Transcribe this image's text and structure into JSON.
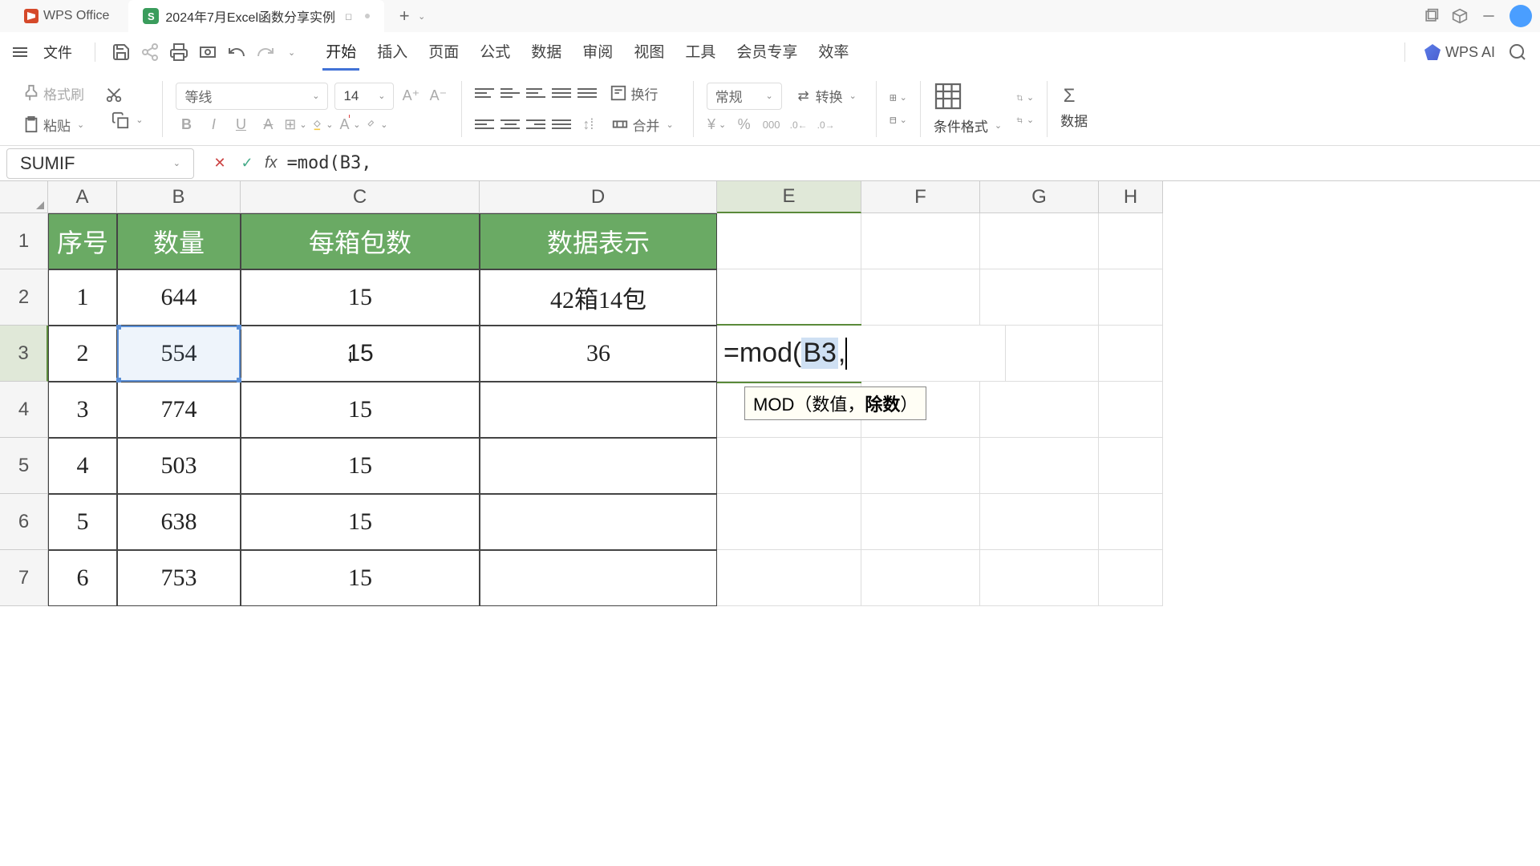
{
  "title_bar": {
    "app_name": "WPS Office",
    "file_tab": "2024年7月Excel函数分享实例"
  },
  "menu": {
    "file": "文件",
    "tabs": [
      "开始",
      "插入",
      "页面",
      "公式",
      "数据",
      "审阅",
      "视图",
      "工具",
      "会员专享",
      "效率"
    ],
    "active_tab": 0,
    "wps_ai": "WPS AI"
  },
  "ribbon": {
    "format_brush": "格式刷",
    "paste": "粘贴",
    "font_name": "等线",
    "font_size": "14",
    "wrap": "换行",
    "merge": "合并",
    "number_format": "常规",
    "convert": "转换",
    "cond_format": "条件格式",
    "data_label": "数据"
  },
  "formula_bar": {
    "name_box": "SUMIF",
    "formula": "=mod(B3,"
  },
  "columns": [
    "A",
    "B",
    "C",
    "D",
    "E",
    "F",
    "G",
    "H"
  ],
  "headers": {
    "A": "序号",
    "B": "数量",
    "C": "每箱包数",
    "D": "数据表示"
  },
  "rows": [
    {
      "n": "1",
      "a": "1",
      "b": "644",
      "c": "15",
      "d": "42箱14包"
    },
    {
      "n": "2",
      "a": "2",
      "b": "554",
      "c": "15",
      "d": "36"
    },
    {
      "n": "3",
      "a": "3",
      "b": "774",
      "c": "15",
      "d": ""
    },
    {
      "n": "4",
      "a": "4",
      "b": "503",
      "c": "15",
      "d": ""
    },
    {
      "n": "5",
      "a": "5",
      "b": "638",
      "c": "15",
      "d": ""
    },
    {
      "n": "6",
      "a": "6",
      "b": "753",
      "c": "15",
      "d": ""
    }
  ],
  "row3_c_display": "1̶5",
  "edit_cell": {
    "prefix": "=mod(",
    "ref": "B3",
    "suffix": ","
  },
  "tooltip": {
    "fn": "MOD",
    "args_prefix": "（数值，",
    "args_bold": "除数",
    "args_suffix": "）"
  }
}
